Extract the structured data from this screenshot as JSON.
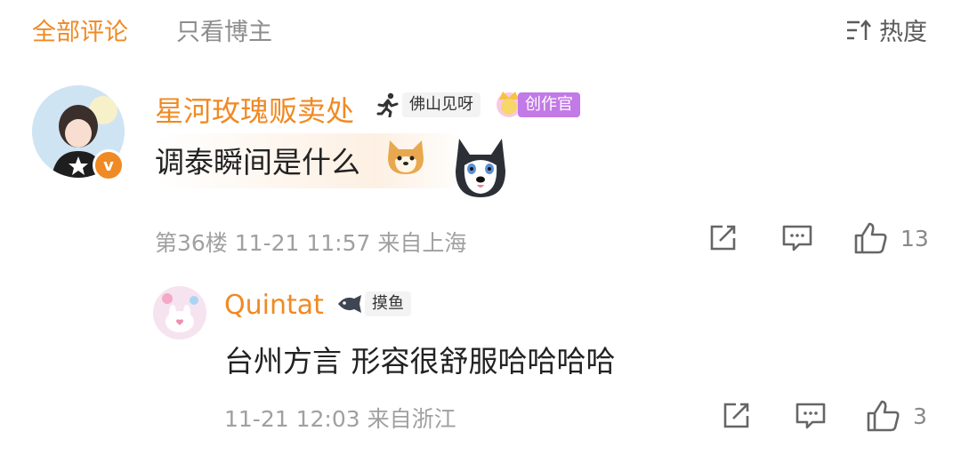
{
  "header": {
    "tab_all": "全部评论",
    "tab_blogger": "只看博主",
    "sort_label": "热度",
    "sort_icon": "sort-icon"
  },
  "comment": {
    "username": "星河玫瑰贩卖处",
    "badge_1": "佛山见呀",
    "badge_2": "创作官",
    "text": "调泰瞬间是什么",
    "meta": "第36楼 11-21 11:57 来自上海",
    "likes": "13",
    "verified_icon": "v",
    "accent_color": "#f08a24"
  },
  "reply": {
    "username": "Quintat",
    "badge": "摸鱼",
    "text": "台州方言 形容很舒服哈哈哈哈",
    "meta": "11-21 12:03 来自浙江",
    "likes": "3"
  }
}
